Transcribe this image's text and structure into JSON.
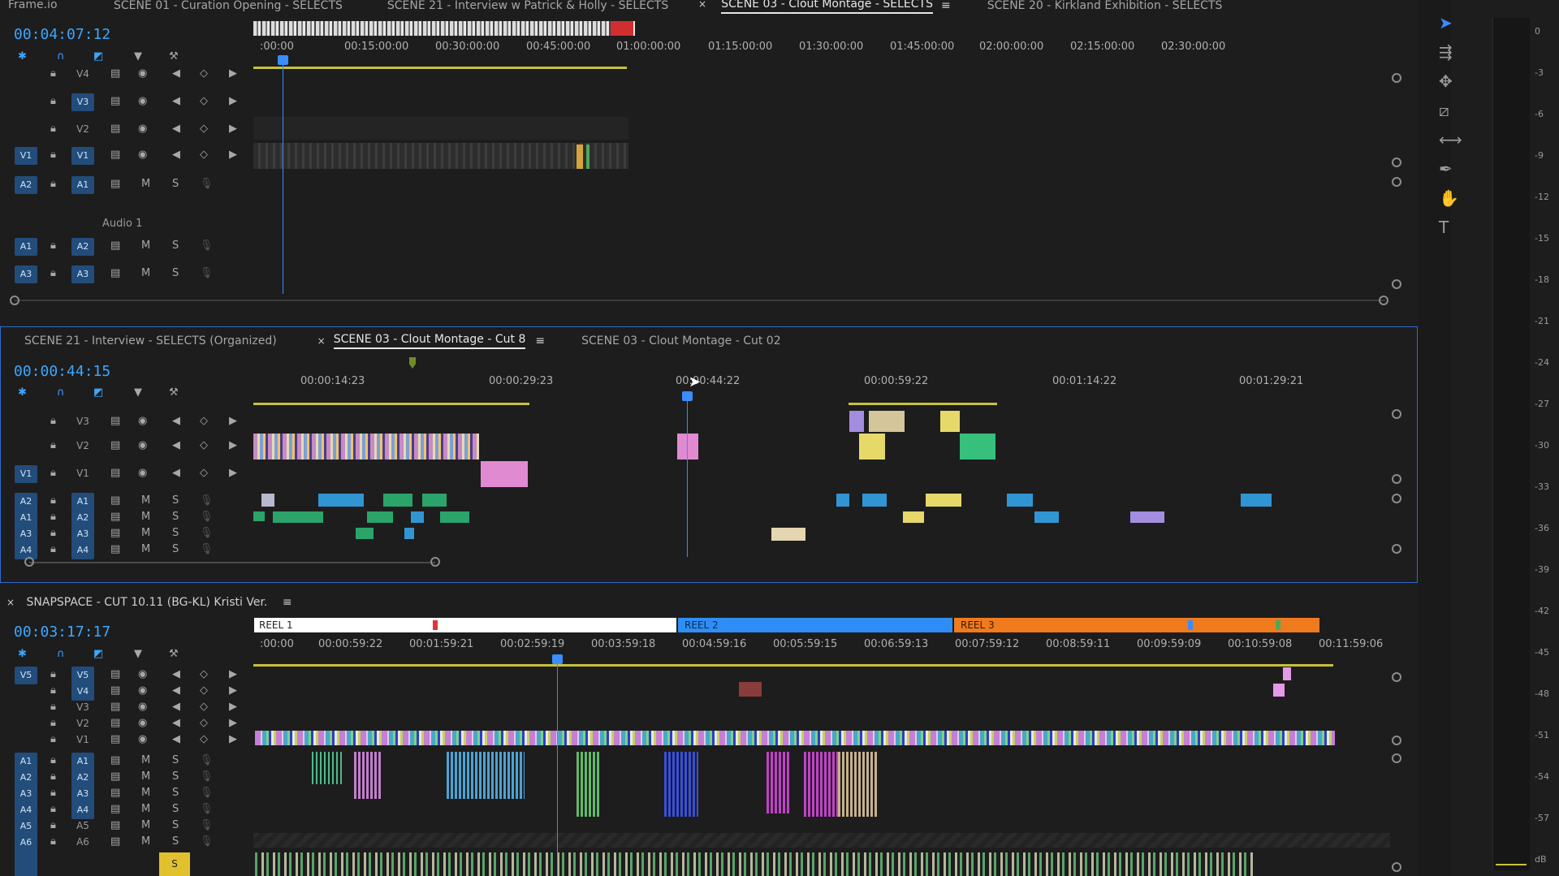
{
  "app": {
    "title": "Frame.io"
  },
  "top_tabs": [
    {
      "label": "SCENE 01 - Curation Opening - SELECTS"
    },
    {
      "label": "SCENE 21 - Interview w Patrick & Holly - SELECTS"
    },
    {
      "label": "SCENE 03 - Clout Montage - SELECTS",
      "active": true
    },
    {
      "label": "SCENE 20 - Kirkland Exhibition - SELECTS"
    }
  ],
  "panel1": {
    "timecode": "00:04:07:12",
    "ruler": [
      ":00:00",
      "00:15:00:00",
      "00:30:00:00",
      "00:45:00:00",
      "01:00:00:00",
      "01:15:00:00",
      "01:30:00:00",
      "01:45:00:00",
      "02:00:00:00",
      "02:15:00:00",
      "02:30:00:00"
    ],
    "video_tracks": [
      "V4",
      "V3",
      "V2",
      "V1"
    ],
    "source_v": "V1",
    "audio_tracks": [
      {
        "src": "A2",
        "tgt": "A1",
        "name": "Audio 1"
      },
      {
        "src": "A1",
        "tgt": "A2"
      },
      {
        "src": "A3",
        "tgt": "A3"
      }
    ]
  },
  "panel2": {
    "tabs": [
      {
        "label": "SCENE 21 - Interview - SELECTS (Organized)"
      },
      {
        "label": "SCENE 03 - Clout Montage - Cut 8",
        "active": true
      },
      {
        "label": "SCENE 03 - Clout Montage - Cut 02"
      }
    ],
    "timecode": "00:00:44:15",
    "ruler": [
      "00:00:14:23",
      "00:00:29:23",
      "00:00:44:22",
      "00:00:59:22",
      "00:01:14:22",
      "00:01:29:21"
    ],
    "video_tracks": [
      "V3",
      "V2",
      "V1"
    ],
    "audio_rows": [
      {
        "src": "A2",
        "tgt": "A1"
      },
      {
        "src": "A1",
        "tgt": "A2"
      },
      {
        "src": "A3",
        "tgt": "A3"
      },
      {
        "src": "A4",
        "tgt": "A4"
      }
    ]
  },
  "panel3": {
    "tab": "SNAPSPACE - CUT 10.11 (BG-KL) Kristi Ver.",
    "timecode": "00:03:17:17",
    "reels": [
      {
        "label": "REEL 1",
        "color": "#ffffff"
      },
      {
        "label": "REEL 2",
        "color": "#2f8ef5"
      },
      {
        "label": "REEL 3",
        "color": "#f07a1e"
      }
    ],
    "ruler": [
      ":00:00",
      "00:00:59:22",
      "00:01:59:21",
      "00:02:59:19",
      "00:03:59:18",
      "00:04:59:16",
      "00:05:59:15",
      "00:06:59:13",
      "00:07:59:12",
      "00:08:59:11",
      "00:09:59:09",
      "00:10:59:08",
      "00:11:59:06"
    ],
    "video_tracks": [
      "V5",
      "V4",
      "V3",
      "V2",
      "V1"
    ],
    "audio_rows": [
      {
        "src": "A1",
        "tgt": "A1"
      },
      {
        "src": "A2",
        "tgt": "A2"
      },
      {
        "src": "A3",
        "tgt": "A3"
      },
      {
        "src": "A4",
        "tgt": "A4"
      },
      {
        "src": "A5",
        "tgt": "A5"
      },
      {
        "src": "A6",
        "tgt": "A6"
      }
    ]
  },
  "track_buttons": {
    "mute": "M",
    "solo": "S"
  },
  "meter": {
    "labels": [
      "0",
      "-3",
      "-6",
      "-9",
      "-12",
      "-15",
      "-18",
      "-21",
      "-24",
      "-27",
      "-30",
      "-33",
      "-36",
      "-39",
      "-42",
      "-45",
      "-48",
      "-51",
      "-54",
      "-57",
      "dB"
    ]
  },
  "colors": {
    "accent": "#3ea6ff",
    "selected": "#224c7a",
    "playhead": "#3a8cff"
  }
}
